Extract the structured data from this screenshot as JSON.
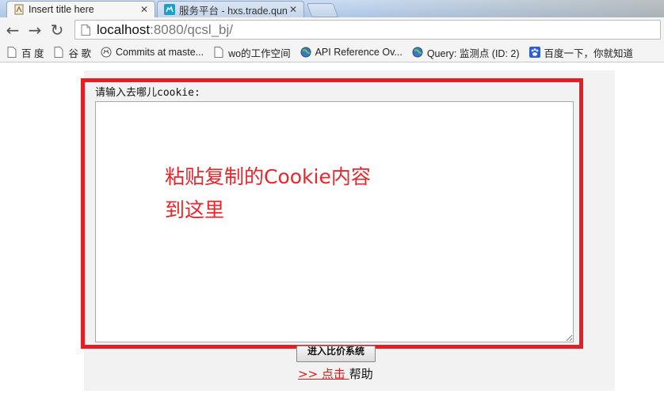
{
  "tabs": [
    {
      "title": "Insert title here",
      "close": "✕",
      "icon": "page-favicon"
    },
    {
      "title": "服务平台 - hxs.trade.qunar.com",
      "close": "✕",
      "icon": "camel-favicon"
    }
  ],
  "nav": {
    "back": "←",
    "forward": "→",
    "reload": "↻"
  },
  "omnibox": {
    "host": "localhost",
    "path": ":8080/qcsl_bj/"
  },
  "bookmarks": [
    {
      "label": "百 度",
      "icon": "page-icon"
    },
    {
      "label": "谷 歌",
      "icon": "page-icon"
    },
    {
      "label": "Commits at maste...",
      "icon": "github-icon"
    },
    {
      "label": "wo的工作空间",
      "icon": "page-icon"
    },
    {
      "label": "API Reference Ov...",
      "icon": "globe-icon"
    },
    {
      "label": "Query: 监测点 (ID: 2)",
      "icon": "globe-icon"
    },
    {
      "label": "百度一下，你就知道",
      "icon": "baidu-paw-icon"
    }
  ],
  "form": {
    "prompt": "请输入去哪儿cookie:",
    "textarea_value": "",
    "annotation": "粘贴复制的Cookie内容到这里",
    "submit_label": "进入比价系统",
    "help_link": ">> 点击 ",
    "help_text": "帮助"
  },
  "colors": {
    "highlight": "#e31e24",
    "annotation": "#e8262c",
    "link": "#d21e1e"
  }
}
